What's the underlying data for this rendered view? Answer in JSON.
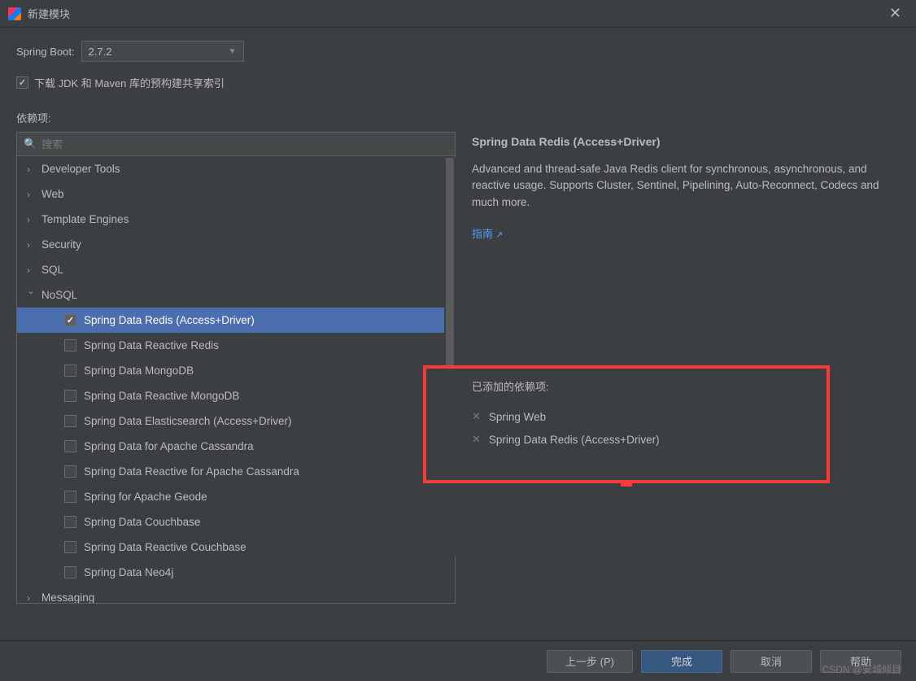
{
  "window": {
    "title": "新建模块"
  },
  "springBoot": {
    "label": "Spring Boot:",
    "selected": "2.7.2"
  },
  "downloadCheckbox": {
    "label": "下载 JDK 和 Maven 库的预构建共享索引",
    "checked": true
  },
  "depsLabel": "依赖项:",
  "search": {
    "placeholder": "搜索"
  },
  "tree": {
    "categories": [
      {
        "label": "Developer Tools",
        "expanded": false
      },
      {
        "label": "Web",
        "expanded": false
      },
      {
        "label": "Template Engines",
        "expanded": false
      },
      {
        "label": "Security",
        "expanded": false
      },
      {
        "label": "SQL",
        "expanded": false
      },
      {
        "label": "NoSQL",
        "expanded": true
      },
      {
        "label": "Messaging",
        "expanded": false
      }
    ],
    "nosqlItems": [
      {
        "label": "Spring Data Redis (Access+Driver)",
        "checked": true,
        "selected": true
      },
      {
        "label": "Spring Data Reactive Redis",
        "checked": false
      },
      {
        "label": "Spring Data MongoDB",
        "checked": false
      },
      {
        "label": "Spring Data Reactive MongoDB",
        "checked": false
      },
      {
        "label": "Spring Data Elasticsearch (Access+Driver)",
        "checked": false
      },
      {
        "label": "Spring Data for Apache Cassandra",
        "checked": false
      },
      {
        "label": "Spring Data Reactive for Apache Cassandra",
        "checked": false
      },
      {
        "label": "Spring for Apache Geode",
        "checked": false
      },
      {
        "label": "Spring Data Couchbase",
        "checked": false
      },
      {
        "label": "Spring Data Reactive Couchbase",
        "checked": false
      },
      {
        "label": "Spring Data Neo4j",
        "checked": false
      }
    ]
  },
  "detail": {
    "title": "Spring Data Redis (Access+Driver)",
    "description": "Advanced and thread-safe Java Redis client for synchronous, asynchronous, and reactive usage. Supports Cluster, Sentinel, Pipelining, Auto-Reconnect, Codecs and much more.",
    "guideLink": "指南"
  },
  "added": {
    "title": "已添加的依赖项:",
    "items": [
      "Spring Web",
      "Spring Data Redis (Access+Driver)"
    ]
  },
  "footer": {
    "prev": "上一步 (P)",
    "finish": "完成",
    "cancel": "取消",
    "help": "帮助"
  },
  "watermark": "CSDN @安城倾目"
}
